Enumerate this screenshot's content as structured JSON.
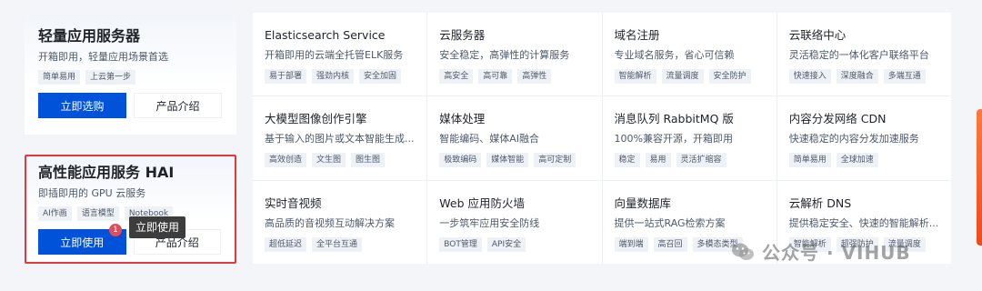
{
  "left_cards": [
    {
      "title": "轻量应用服务器",
      "subtitle": "开箱即用，轻量应用场景首选",
      "tags": [
        "简单易用",
        "上云第一步"
      ],
      "primary_button": "立即选购",
      "secondary_button": "产品介绍"
    },
    {
      "title": "高性能应用服务 HAI",
      "subtitle": "即插即用的 GPU 云服务",
      "tags": [
        "AI作画",
        "语言模型",
        "Notebook"
      ],
      "primary_button": "立即使用",
      "secondary_button": "产品介绍",
      "badge": "1",
      "tooltip": "立即使用"
    }
  ],
  "products": [
    {
      "title": "Elasticsearch Service",
      "desc": "开箱即用的云端全托管ELK服务",
      "tags": [
        "易于部署",
        "强劲内核",
        "安全加固"
      ]
    },
    {
      "title": "云服务器",
      "desc": "安全稳定，高弹性的计算服务",
      "tags": [
        "高安全",
        "高可靠",
        "高弹性"
      ]
    },
    {
      "title": "域名注册",
      "desc": "专业域名服务，省心可信赖",
      "tags": [
        "智能解析",
        "流量调度",
        "安全防护"
      ]
    },
    {
      "title": "云联络中心",
      "desc": "灵活稳定的一体化客户联络平台",
      "tags": [
        "快速接入",
        "深度融合",
        "多端互通"
      ]
    },
    {
      "title": "大模型图像创作引擎",
      "desc": "基于输入的图片或文本智能生成...",
      "tags": [
        "高效创造",
        "文生图",
        "图生图"
      ]
    },
    {
      "title": "媒体处理",
      "desc": "智能编码、媒体AI融合",
      "tags": [
        "极致编码",
        "媒体智能",
        "高可定制"
      ]
    },
    {
      "title": "消息队列 RabbitMQ 版",
      "desc": "100%兼容开源，开箱即用",
      "tags": [
        "稳定",
        "易用",
        "灵活扩缩容"
      ]
    },
    {
      "title": "内容分发网络 CDN",
      "desc": "快速稳定的内容分发加速服务",
      "tags": [
        "简单易用",
        "全球加速"
      ]
    },
    {
      "title": "实时音视频",
      "desc": "高品质的音视频互动解决方案",
      "tags": [
        "超低延迟",
        "全平台互通"
      ]
    },
    {
      "title": "Web 应用防火墙",
      "desc": "一步筑牢应用安全防线",
      "tags": [
        "BOT管理",
        "API安全"
      ]
    },
    {
      "title": "向量数据库",
      "desc": "提供一站式RAG检索方案",
      "tags": [
        "端到端",
        "高召回",
        "多模态类型"
      ]
    },
    {
      "title": "云解析 DNS",
      "desc": "提供稳定安全、快速的智能解析...",
      "tags": [
        "智能解析",
        "超强防护",
        "流量调度"
      ]
    }
  ],
  "watermark": {
    "text": "公众号 · VIHUB",
    "icon": "wechat-icon"
  },
  "colors": {
    "primary": "#0052d9",
    "highlight_border": "#e23a3a",
    "badge": "#e34d59"
  }
}
